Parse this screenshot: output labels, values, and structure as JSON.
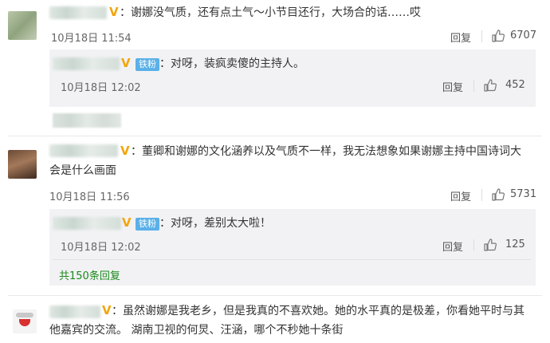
{
  "colors": {
    "vip_badge": "#f2a50c",
    "fan_badge": "#5ab0e8",
    "more_link": "#1a8a1a",
    "reply_bg": "#f2f2f5"
  },
  "comments": [
    {
      "vip_mark": "V",
      "text": "：谢娜没气质，还有点土气～小节目还行，大场合的话……哎",
      "time": "10月18日 11:54",
      "reply_label": "回复",
      "likes": "6707",
      "replies": [
        {
          "vip_mark": "V",
          "fan_badge": "铁粉",
          "text": "：对呀，装疯卖傻的主持人。",
          "time": "10月18日 12:02",
          "reply_label": "回复",
          "likes": "452"
        }
      ]
    },
    {
      "vip_mark": "V",
      "text_line1": "：董卿和谢娜的文化涵养以及气质不一样，我无法想象如果谢娜主持中国诗词大",
      "text_line2": "会是什么画面",
      "time": "10月18日 11:56",
      "reply_label": "回复",
      "likes": "5731",
      "replies": [
        {
          "vip_mark": "V",
          "fan_badge": "铁粉",
          "text": "：对呀，差别太大啦！",
          "time": "10月18日 12:02",
          "reply_label": "回复",
          "likes": "125"
        }
      ],
      "more_replies": "共150条回复"
    },
    {
      "vip_mark": "V",
      "text_line1": "：虽然谢娜是我老乡，但是我真的不喜欢她。她的水平真的是极差，你看她平时与其",
      "text_line2": "他嘉宾的交流。 湖南卫视的何炅、汪涵，哪个不秒她十条街"
    }
  ]
}
